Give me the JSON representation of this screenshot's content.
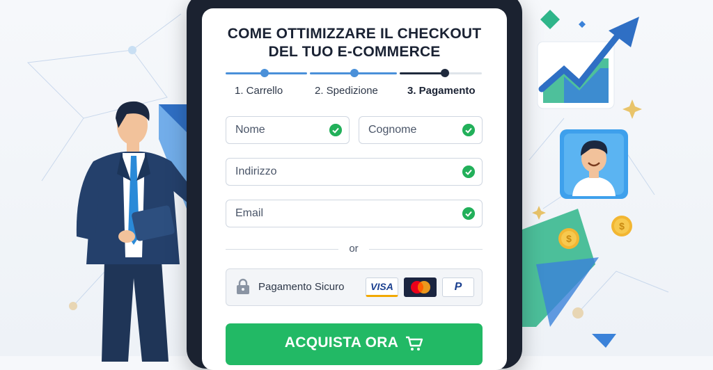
{
  "colors": {
    "accent_blue": "#4a90d9",
    "step_dark": "#1f2a3d",
    "success_green": "#22b05a",
    "button_green": "#22b965",
    "tablet_frame": "#1b2230"
  },
  "checkout": {
    "title_line1": "COME OTTIMIZZARE IL CHECKOUT",
    "title_line2": "DEL TUO E-COMMERCE",
    "steps": [
      {
        "label": "1. Carrello",
        "state": "completed"
      },
      {
        "label": "2. Spedizione",
        "state": "completed"
      },
      {
        "label": "3. Pagamento",
        "state": "active"
      }
    ],
    "fields": {
      "first_name_placeholder": "Nome",
      "last_name_placeholder": "Cognome",
      "address_placeholder": "Indirizzo",
      "email_placeholder": "Email"
    },
    "divider_text": "or",
    "secure_payment": {
      "label": "Pagamento Sicuro",
      "methods": [
        "VISA",
        "Mastercard",
        "PayPal"
      ],
      "visa_text": "VISA",
      "paypal_text": "P"
    },
    "buy_button": {
      "label": "ACQUISTA ORA",
      "icon": "cart-icon"
    }
  },
  "illustrations": {
    "presenter": "businessman-pointing",
    "chart_card": "growth-chart-icon",
    "avatar_card": "happy-user-avatar",
    "coins": "coin-icon"
  }
}
